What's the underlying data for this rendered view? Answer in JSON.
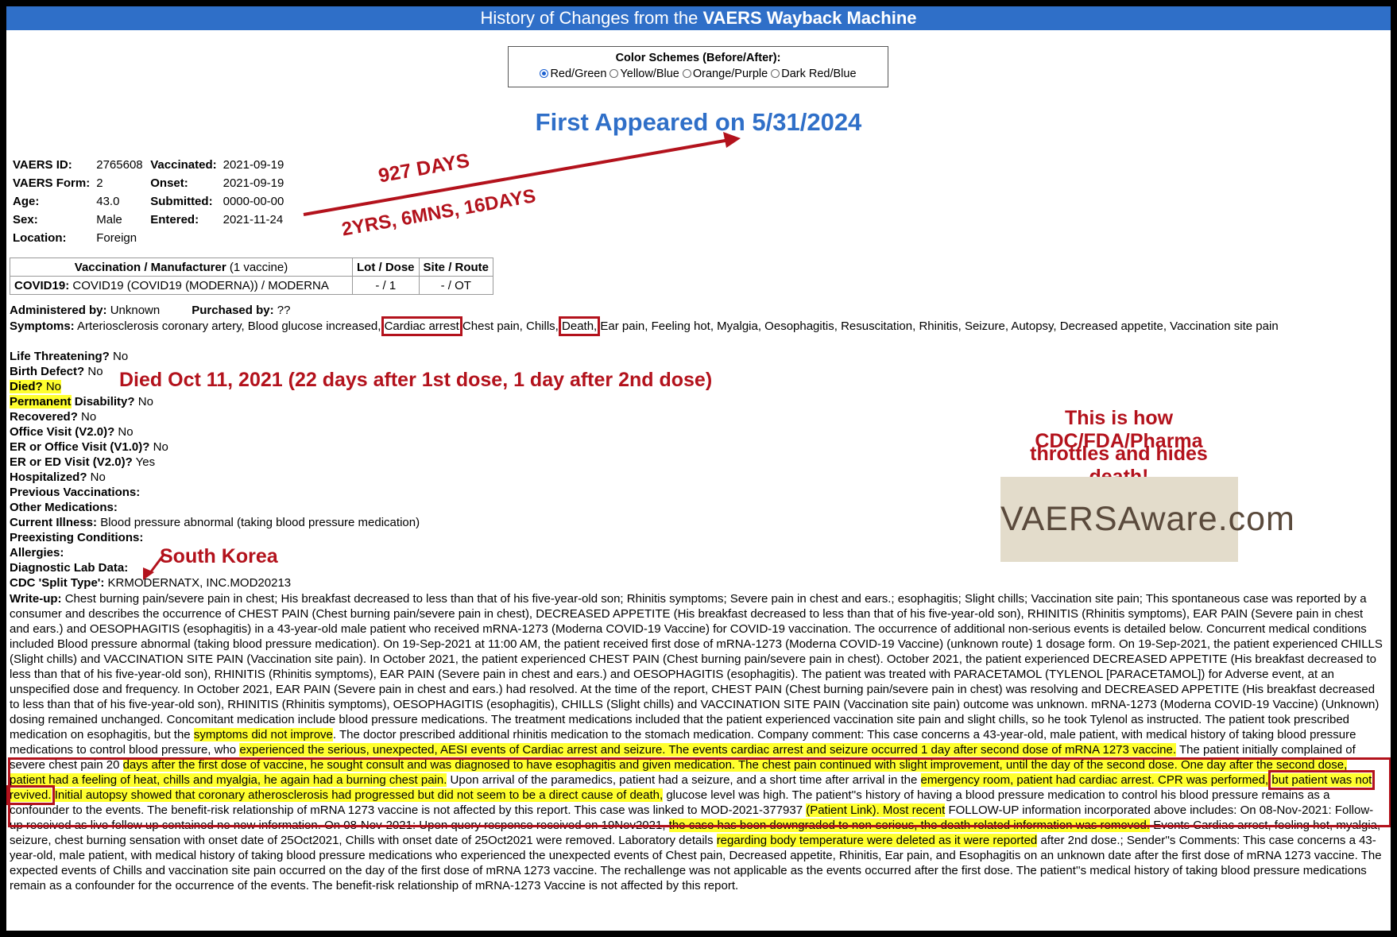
{
  "banner": {
    "prefix": "History of Changes from the ",
    "bold": "VAERS Wayback Machine"
  },
  "color_schemes": {
    "title": "Color Schemes (Before/After):",
    "options": [
      "Red/Green",
      "Yellow/Blue",
      "Orange/Purple",
      "Dark Red/Blue"
    ],
    "selected": "Red/Green"
  },
  "first_appeared": "First Appeared on 5/31/2024",
  "info": {
    "vaers_id_label": "VAERS ID:",
    "vaers_id": "2765608",
    "form_label": "VAERS Form:",
    "form": "2",
    "age_label": "Age:",
    "age": "43.0",
    "sex_label": "Sex:",
    "sex": "Male",
    "location_label": "Location:",
    "location": "Foreign",
    "vaccinated_label": "Vaccinated:",
    "vaccinated": "2021-09-19",
    "onset_label": "Onset:",
    "onset": "2021-09-19",
    "submitted_label": "Submitted:",
    "submitted": "0000-00-00",
    "entered_label": "Entered:",
    "entered": "2021-11-24"
  },
  "vax_table": {
    "h_vax": "Vaccination / Manufacturer",
    "h_vax_count": " (1 vaccine)",
    "h_lot": "Lot / Dose",
    "h_site": "Site / Route",
    "row_bold": "COVID19:",
    "row_rest": " COVID19 (COVID19 (MODERNA)) / MODERNA",
    "row_lot": "- / 1",
    "row_site": "- / OT"
  },
  "fields": {
    "administered_label": "Administered by:",
    "administered": " Unknown",
    "purchased_label": "Purchased by:",
    "purchased": " ??",
    "symptoms_label": "Symptoms:",
    "symptoms_a": " Arteriosclerosis coronary artery, Blood glucose increased,",
    "symptoms_cardiac": "Cardiac arrest",
    "symptoms_b": " Chest pain, Chills,",
    "symptoms_death": "Death,",
    "symptoms_c": " Ear pain, Feeling hot, Myalgia, Oesophagitis, Resuscitation, Rhinitis, Seizure, Autopsy, Decreased appetite, Vaccination site",
    "symptoms_d": "pain",
    "life_label": "Life Threatening?",
    "life": " No",
    "birth_label": "Birth Defect?",
    "birth": " No",
    "died_label": "Died?",
    "died": " No",
    "perm_label": "Permanent",
    "perm_label2": " Disability?",
    "perm": " No",
    "recovered_label": "Recovered?",
    "recovered": " No",
    "office_label": "Office Visit (V2.0)?",
    "office": " No",
    "er1_label": "ER or Office Visit (V1.0)?",
    "er1": " No",
    "er2_label": "ER or ED Visit (V2.0)?",
    "er2": " Yes",
    "hosp_label": "Hospitalized?",
    "hosp": " No",
    "prev_label": "Previous Vaccinations:",
    "other_label": "Other Medications:",
    "illness_label": "Current Illness:",
    "illness": " Blood pressure abnormal (taking blood pressure medication)",
    "preexisting_label": "Preexisting Conditions:",
    "allergies_label": "Allergies:",
    "lab_label": "Diagnostic Lab Data:",
    "split_label": "CDC 'Split Type':",
    "split": " KRMODERNATX, INC.MOD20213"
  },
  "writeup": {
    "label": "Write-up:",
    "p1": " Chest burning pain/severe pain in chest; His breakfast decreased to less than that of his five-year-old son; Rhinitis symptoms; Severe pain in chest and ears.; esophagitis; Slight chills; Vaccination site pain; This spontaneous case was reported by a consumer and describes the occurrence of CHEST PAIN (Chest burning pain/severe pain in chest), DECREASED APPETITE (His breakfast decreased to less than that of his five-year-old son), RHINITIS (Rhinitis symptoms), EAR PAIN (Severe pain in chest and ears.) and OESOPHAGITIS (esophagitis) in a 43-year-old male patient who received mRNA-1273 (Moderna COVID-19 Vaccine) for COVID-19 vaccination. The occurrence of additional non-serious events is detailed below. Concurrent medical conditions included Blood pressure abnormal (taking blood pressure medication). On 19-Sep-2021 at 11:00 AM, the patient received first dose of mRNA-1273 (Moderna COVID-19 Vaccine) (unknown route) 1 dosage form. On 19-Sep-2021, the patient experienced CHILLS (Slight chills) and VACCINATION SITE PAIN (Vaccination site pain). In October 2021, the patient experienced CHEST PAIN (Chest burning pain/severe pain in chest). October 2021, the patient experienced DECREASED APPETITE (His breakfast decreased to less than that of his five-year-old son), RHINITIS (Rhinitis symptoms), EAR PAIN (Severe pain in chest and ears.) and OESOPHAGITIS (esophagitis). The patient was treated with PARACETAMOL (TYLENOL [PARACETAMOL]) for Adverse event, at an unspecified dose and frequency. In October 2021, EAR PAIN (Severe pain in chest and ears.) had resolved. At the time of the report, CHEST PAIN (Chest burning pain/severe pain in chest) was resolving and DECREASED APPETITE (His breakfast decreased to less than that of his five-year-old son), RHINITIS (Rhinitis symptoms), OESOPHAGITIS (esophagitis), CHILLS (Slight chills) and VACCINATION SITE PAIN (Vaccination site pain) outcome was unknown. mRNA-1273 (Moderna COVID-19 Vaccine) (Unknown) dosing remained unchanged. Concomitant medication include blood pressure medications. The treatment medications included that the patient experienced vaccination site pain and slight chills, so he took Tylenol as instructed. The patient took prescribed medication on esophagitis, but the ",
    "hl1": "symptoms did not improve",
    "p2": ". The doctor prescribed additional rhinitis medication to the stomach medication. Company comment: This case concerns a 43-year-old, male patient, with medical history of taking blood pressure medications to control blood pressure, who ",
    "hl2": "experienced the serious, unexpected, AESI events of Cardiac arrest and seizure. The events cardiac arrest and seizure occurred 1 day after second dose of mRNA 1273 vaccine.",
    "p3": " The patient initially complained of severe chest pain 20 ",
    "hl3": "days after the first dose of vaccine, he sought consult and was diagnosed to have esophagitis and given medication. The chest pain continued with slight improvement, until the day of the second dose. One day after the second dose, patient had a feeling of heat, chills and myalgia, he again had a burning chest pain.",
    "p4": " Upon arrival of the paramedics, patient had a seizure, and a short time after arrival in the ",
    "hl4": "emergency room, patient had cardiac arrest. CPR was performed,",
    "p5": " ",
    "hl5": "but patient was not revived.",
    "p6": " ",
    "hl6": "Initial autopsy showed that coronary atherosclerosis had progressed but did not seem to be a direct cause of death,",
    "p7": " glucose level was high. The patient''s history of having a blood pressure medication to control his blood pressure remains as a confounder to the events. The benefit-risk relationship of mRNA 1273 vaccine is not affected by this report. This case was linked to MOD-2021-377937 ",
    "hl7": "(Patient Link). Most recent",
    "p8": " FOLLOW-UP information incorporated above includes: On 08-Nov-2021: Follow-up received as live follow up contained no new information. On 08-Nov-2021: Upon query response received on 19Nov2021, ",
    "hl8": "the case has been downgraded to non-serious, the death related information was removed.",
    "p9": " Events Cardiac arrest, feeling hot, myalgia, seizure, chest burning sensation with onset date of 25Oct2021, Chills with onset date of 25Oct2021 were removed. Laboratory details ",
    "hl9": "regarding body temperature were deleted as it were reported",
    "p10": " after 2nd dose.; Sender''s Comments: This case concerns a 43-year-old, male patient, with medical history of taking blood pressure medications who experienced the unexpected events of Chest pain, Decreased appetite, Rhinitis, Ear pain, and Esophagitis on an unknown date after the first dose of mRNA 1273 vaccine. The expected events of Chills and vaccination site pain occurred on the day of the first dose of mRNA 1273 vaccine. The rechallenge was not applicable as the events occurred after the first dose. The patient''s medical history of taking blood pressure medications remain as a confounder for the occurrence of the events. The benefit-risk relationship of mRNA-1273 Vaccine is not affected by this report."
  },
  "annotations": {
    "days": "927 DAYS",
    "span": "2YRS, 6MNS, 16DAYS",
    "died": "Died Oct 11, 2021 (22 days after 1st dose, 1 day after 2nd dose)",
    "hides1": "This is how CDC/FDA/Pharma",
    "hides2": "throttles and hides death!",
    "korea": "South Korea",
    "logo": "VAERSAware.com"
  },
  "colors": {
    "banner": "#2f6fc8",
    "annotation_red": "#b3121c",
    "highlight": "#ffff2e"
  }
}
